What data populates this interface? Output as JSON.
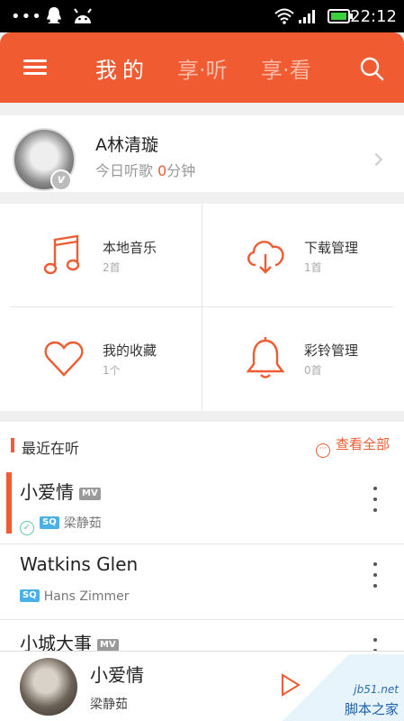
{
  "status_bar": {
    "dots": "•••",
    "time": "22:12"
  },
  "header": {
    "tabs": [
      {
        "label": "我的",
        "active": true
      },
      {
        "label": "享·听",
        "active": false
      },
      {
        "label": "享·看",
        "active": false
      }
    ]
  },
  "profile": {
    "name": "A林清璇",
    "today_prefix": "今日听歌 ",
    "today_minutes": "0",
    "today_suffix": "分钟"
  },
  "grid": [
    {
      "label": "本地音乐",
      "count": "2首",
      "icon": "music-note-icon"
    },
    {
      "label": "下载管理",
      "count": "1首",
      "icon": "cloud-download-icon"
    },
    {
      "label": "我的收藏",
      "count": "1个",
      "icon": "heart-icon"
    },
    {
      "label": "彩铃管理",
      "count": "0首",
      "icon": "bell-icon"
    }
  ],
  "recent": {
    "title": "最近在听",
    "view_all": "查看全部",
    "view_all_icon": "···",
    "songs": [
      {
        "title": "小爱情",
        "tag": "MV",
        "quality": "SQ",
        "artist": "梁静茹"
      },
      {
        "title": "Watkins Glen",
        "quality": "SQ",
        "artist": "Hans Zimmer"
      },
      {
        "title": "小城大事",
        "tag": "MV"
      }
    ]
  },
  "player": {
    "title": "小爱情",
    "artist": "梁静茹"
  },
  "watermark": {
    "url": "jb51.net",
    "name": "脚本之家"
  },
  "colors": {
    "accent": "#f05b32",
    "sq_badge": "#4ab1e8",
    "check": "#5fc6a8"
  }
}
